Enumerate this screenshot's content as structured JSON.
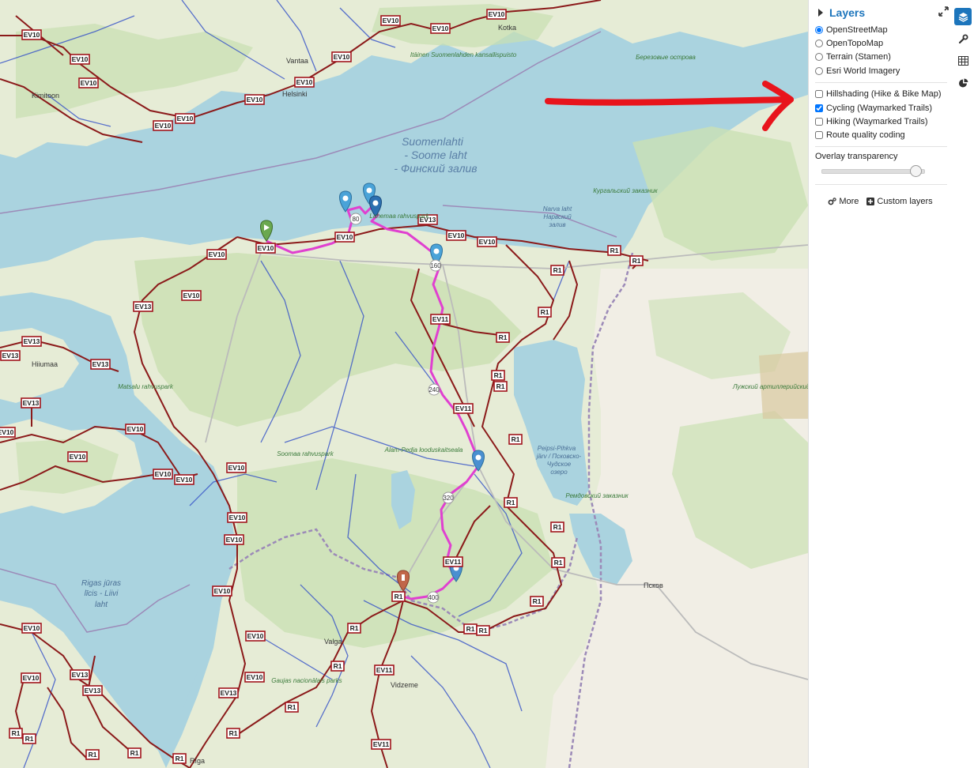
{
  "layers_panel": {
    "title": "Layers",
    "base_layers": [
      {
        "label": "OpenStreetMap",
        "selected": true
      },
      {
        "label": "OpenTopoMap",
        "selected": false
      },
      {
        "label": "Terrain (Stamen)",
        "selected": false
      },
      {
        "label": "Esri World Imagery",
        "selected": false
      }
    ],
    "overlays": [
      {
        "label": "Hillshading (Hike & Bike Map)",
        "checked": false
      },
      {
        "label": "Cycling (Waymarked Trails)",
        "checked": true
      },
      {
        "label": "Hiking (Waymarked Trails)",
        "checked": false
      },
      {
        "label": "Route quality coding",
        "checked": false
      }
    ],
    "transparency_label": "Overlay transparency",
    "transparency_value": 0.95,
    "more_label": "More",
    "custom_layers_label": "Custom layers"
  },
  "rail": {
    "icons": [
      "layers-icon",
      "wrench-icon",
      "table-icon",
      "pie-chart-icon"
    ]
  },
  "map": {
    "sea_labels": [
      "Suomenlahti",
      "- Soome laht",
      "- Финский залив"
    ],
    "gulf_riga_labels": [
      "Rigas jūras",
      "līcis - Liivi",
      "laht"
    ],
    "narva_labels": [
      "Narva laht",
      "Нарвский",
      "залив"
    ],
    "peipsi_labels": [
      "Peipsi-Pihkva",
      "järv / Псковско-",
      "Чудское",
      "озеро"
    ],
    "places": {
      "helsinki": "Helsinki",
      "vantaa": "Vantaa",
      "kimitoon": "Kimitoon",
      "hiiumaa": "Hiiumaa",
      "pskov": "Псков",
      "valga": "Valga",
      "vidzeme": "Vidzeme",
      "riga": "Rīga",
      "kotka": "Kotka"
    },
    "parks": {
      "itainen": "Itäinen Suomenlahden kansallispuisto",
      "lahemaa": "Lahemaa rahvuspark",
      "soomaa": "Soomaa rahvuspark",
      "matsalu": "Matsalu rahvuspark",
      "alam_pedja": "Alam-Pedja looduskaitseala",
      "kurgalsky": "Кургальский заказник",
      "gauja": "Gaujas nacionālais parks",
      "remda": "Ремдовский заказник",
      "luzhsky": "Лужский артиллерийский полигон",
      "berezovye": "Березовые острова"
    },
    "route_names": [
      "EV10",
      "EV13",
      "EV11",
      "R1"
    ],
    "distance_markers": [
      "80",
      "160",
      "240",
      "320",
      "400"
    ]
  }
}
